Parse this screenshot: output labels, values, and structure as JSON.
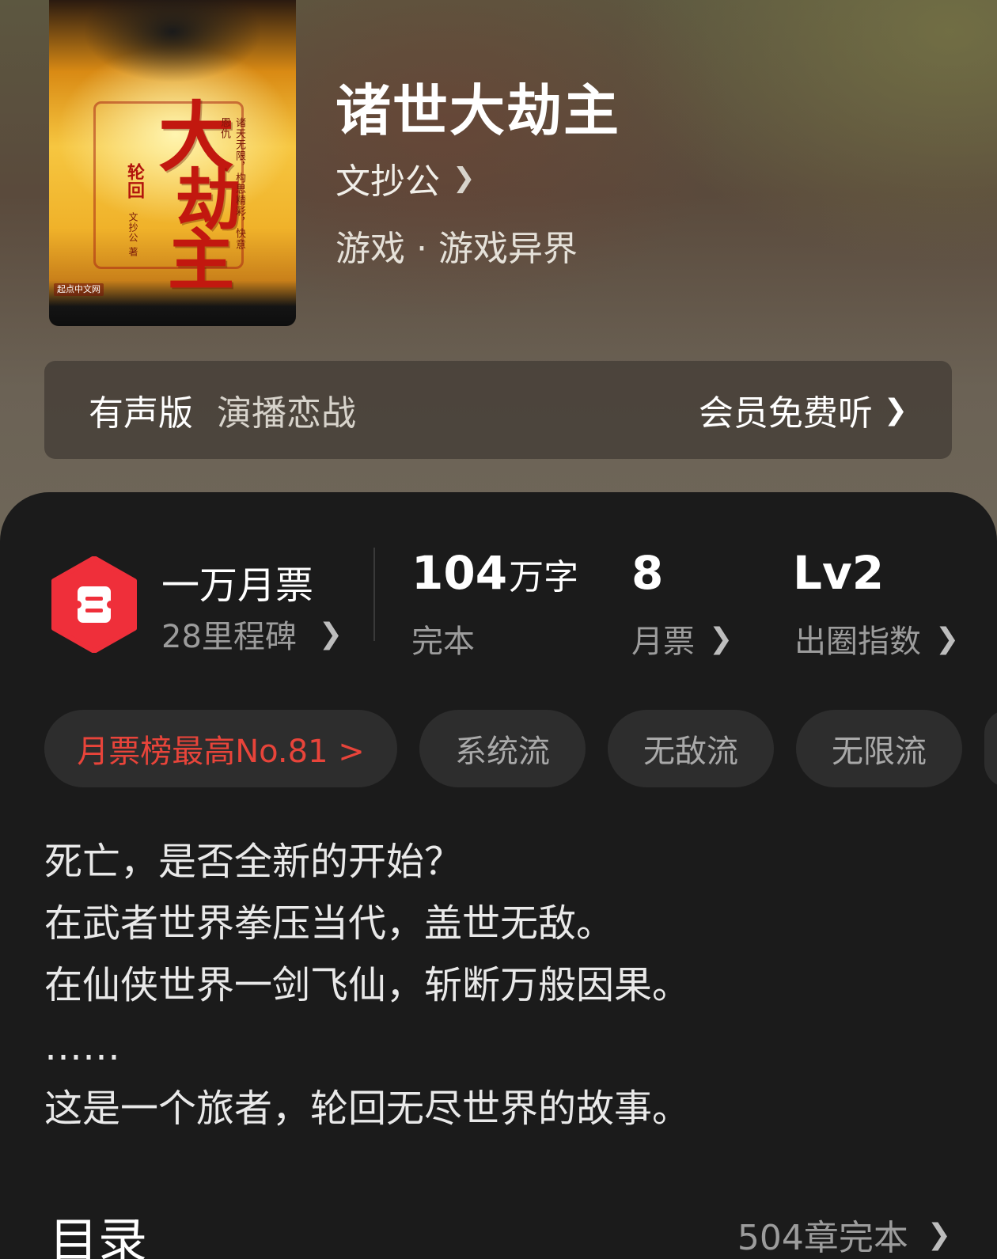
{
  "book": {
    "title": "诸世大劫主",
    "author": "文抄公",
    "genre_main": "游戏",
    "genre_sep": "·",
    "genre_sub": "游戏异界",
    "cover": {
      "title_chars": [
        "大",
        "劫",
        "主"
      ],
      "series_mark": "轮回",
      "tagline": "诸天无限，构思精彩，快意恩仇",
      "author_mark": "文抄公 著",
      "publisher": "起点中文网"
    }
  },
  "audio": {
    "label": "有声版",
    "narrator": "演播恋战",
    "cta": "会员免费听"
  },
  "stats": {
    "monthly_ticket_title": "一万月票",
    "milestones": "28里程碑",
    "word_count": "104",
    "word_unit": "万字",
    "status": "完本",
    "month_tickets": "8",
    "month_tickets_label": "月票",
    "level": "Lv2",
    "level_label": "出圈指数"
  },
  "tags": {
    "rank": "月票榜最高No.81 >",
    "items": [
      "系统流",
      "无敌流",
      "无限流"
    ]
  },
  "intro": [
    "死亡，是否全新的开始？",
    "在武者世界拳压当代，盖世无敌。",
    "在仙侠世界一剑飞仙，斩断万般因果。",
    "……",
    "这是一个旅者，轮回无尽世界的故事。"
  ],
  "toc": {
    "title": "目录",
    "count": "504章完本"
  },
  "colors": {
    "accent_red": "#e8443a",
    "panel_bg": "#1b1b1b",
    "chip_bg": "#2d2d2d"
  },
  "icons": {
    "ticket": "ticket-hexagon-icon",
    "chevron": "chevron-right-icon"
  }
}
